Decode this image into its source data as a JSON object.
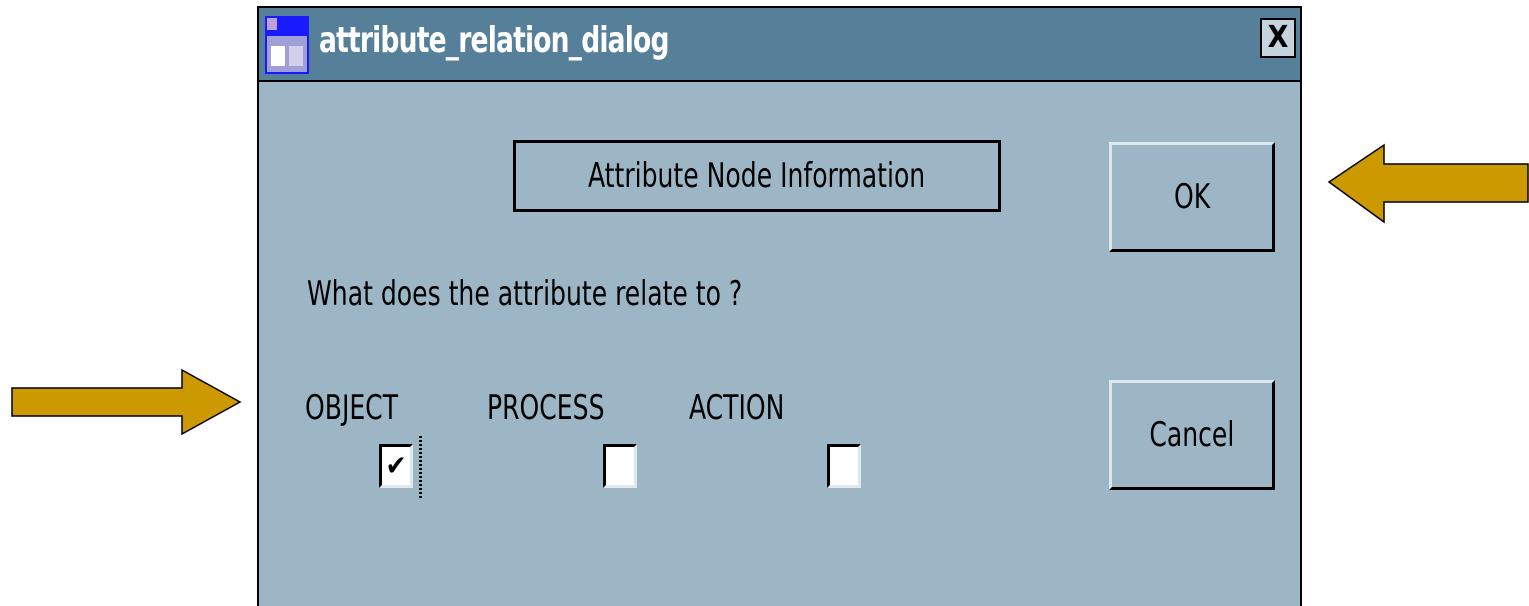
{
  "window": {
    "title": "attribute_relation_dialog",
    "close_glyph": "X"
  },
  "dialog": {
    "heading": "Attribute Node Information",
    "question": "What does the attribute relate to ?",
    "options": [
      {
        "label": "OBJECT",
        "checked": true
      },
      {
        "label": "PROCESS",
        "checked": false
      },
      {
        "label": "ACTION",
        "checked": false
      }
    ],
    "check_glyph": "✔",
    "ok_label": "OK",
    "cancel_label": "Cancel"
  },
  "colors": {
    "window_bg": "#9db6c6",
    "titlebar_bg": "#56809a",
    "arrow_fill": "#cc9900"
  },
  "icons": {
    "app_icon": "app-window-icon",
    "close_icon": "close-icon",
    "callout_arrows": [
      "arrow-left-icon",
      "arrow-right-icon"
    ]
  }
}
